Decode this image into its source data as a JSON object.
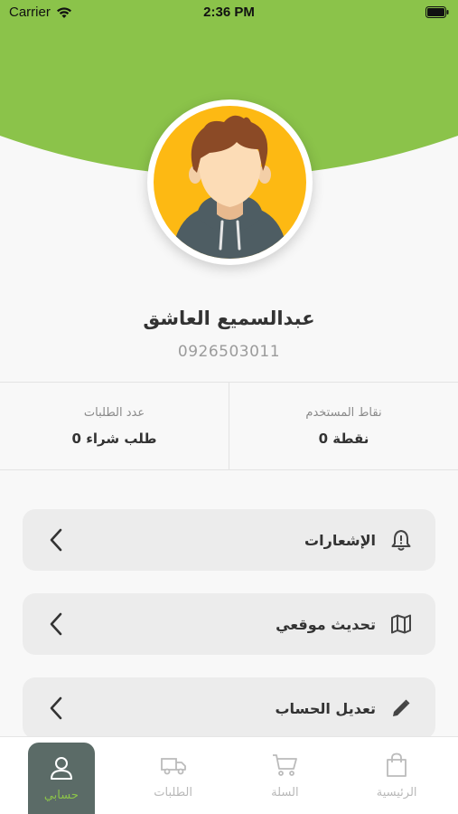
{
  "status_bar": {
    "carrier": "Carrier",
    "time": "2:36 PM"
  },
  "colors": {
    "accent": "#8bc34a",
    "tab_active_bg": "#5b6b67",
    "avatar_bg": "#fdb913"
  },
  "profile": {
    "name": "عبدالسميع العاشق",
    "phone": "0926503011"
  },
  "stats": [
    {
      "label": "نقاط المستخدم",
      "value": "0 نقطة"
    },
    {
      "label": "عدد الطلبات",
      "value": "0 طلب شراء"
    }
  ],
  "menu": [
    {
      "label": "الإشعارات",
      "icon": "bell-icon"
    },
    {
      "label": "تحديث موقعي",
      "icon": "map-icon"
    },
    {
      "label": "تعديل الحساب",
      "icon": "pencil-icon"
    }
  ],
  "tabs": [
    {
      "label": "حسابي",
      "icon": "user-icon",
      "active": true
    },
    {
      "label": "الطلبات",
      "icon": "truck-icon",
      "active": false
    },
    {
      "label": "السلة",
      "icon": "cart-icon",
      "active": false
    },
    {
      "label": "الرئيسية",
      "icon": "shopping-bag-icon",
      "active": false
    }
  ]
}
